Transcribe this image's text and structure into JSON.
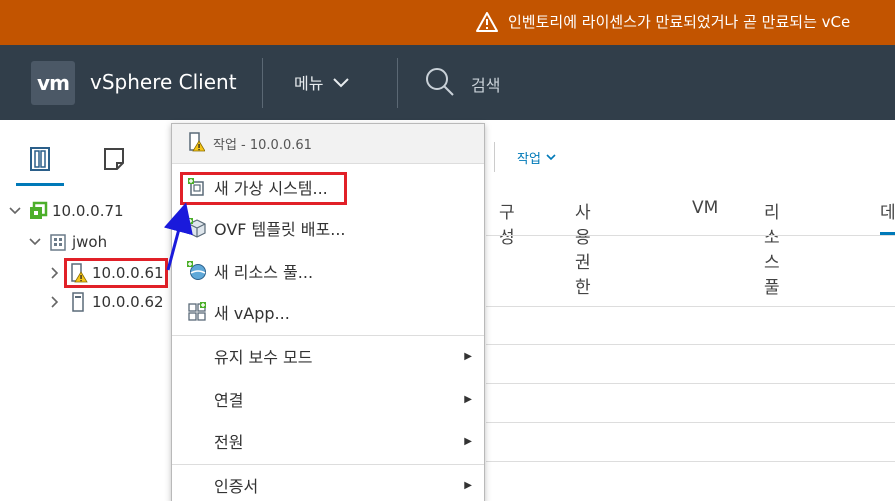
{
  "alert": {
    "text": "인벤토리에 라이센스가 만료되었거나 곧 만료되는 vCe",
    "icon": "warning-triangle-icon",
    "color": "#c25400"
  },
  "header": {
    "logo": "vm",
    "title": "vSphere Client",
    "menu_label": "메뉴",
    "search_placeholder": "검색",
    "bg_color": "#313e4a"
  },
  "navigator": {
    "tabs": [
      {
        "icon": "hosts-and-clusters-icon",
        "active": true
      },
      {
        "icon": "vms-and-templates-icon",
        "active": false
      }
    ],
    "tree": [
      {
        "label": "10.0.0.71",
        "icon": "vcenter-icon",
        "expanded": true
      },
      {
        "label": "jwoh",
        "icon": "datacenter-icon",
        "expanded": true
      },
      {
        "label": "10.0.0.61",
        "icon": "host-warning-icon",
        "expanded": false,
        "selected": true
      },
      {
        "label": "10.0.0.62",
        "icon": "host-icon",
        "expanded": false
      }
    ]
  },
  "content": {
    "actions_label": "작업",
    "tabs": [
      "구성",
      "사용 권한",
      "VM",
      "리소스 풀",
      "데"
    ]
  },
  "context_menu": {
    "header": "작업 - 10.0.0.61",
    "items": [
      {
        "label": "새 가상 시스템...",
        "icon": "new-vm-icon",
        "submenu": false
      },
      {
        "label": "OVF 템플릿 배포...",
        "icon": "ovf-deploy-icon",
        "submenu": false
      },
      {
        "label": "새 리소스 풀...",
        "icon": "new-resource-pool-icon",
        "submenu": false
      },
      {
        "label": "새 vApp...",
        "icon": "new-vapp-icon",
        "submenu": false
      },
      {
        "label": "유지 보수 모드",
        "icon": "",
        "submenu": true
      },
      {
        "label": "연결",
        "icon": "",
        "submenu": true
      },
      {
        "label": "전원",
        "icon": "",
        "submenu": true
      },
      {
        "label": "인증서",
        "icon": "",
        "submenu": true
      }
    ]
  },
  "annotation_color": "#e12028"
}
